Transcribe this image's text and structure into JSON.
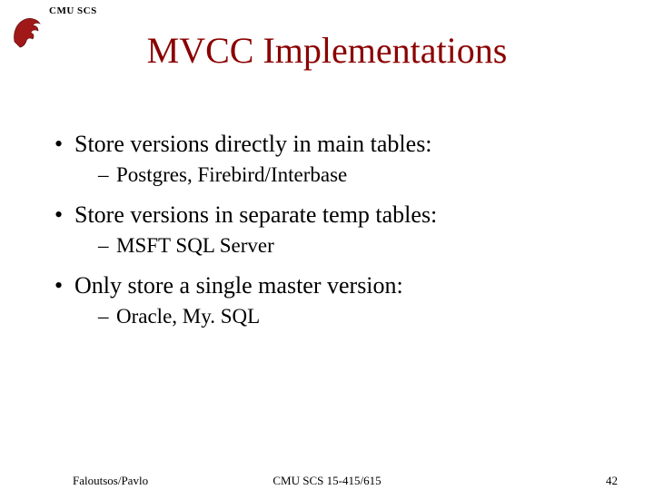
{
  "header": {
    "label": "CMU SCS"
  },
  "title": "MVCC Implementations",
  "bullets": [
    {
      "l1": "Store versions directly in main tables:",
      "l2": "Postgres, Firebird/Interbase"
    },
    {
      "l1": "Store versions in separate temp tables:",
      "l2": "MSFT SQL Server"
    },
    {
      "l1": "Only store a single master version:",
      "l2": "Oracle, My. SQL"
    }
  ],
  "footer": {
    "left": "Faloutsos/Pavlo",
    "center": "CMU SCS 15-415/615",
    "right": "42"
  }
}
